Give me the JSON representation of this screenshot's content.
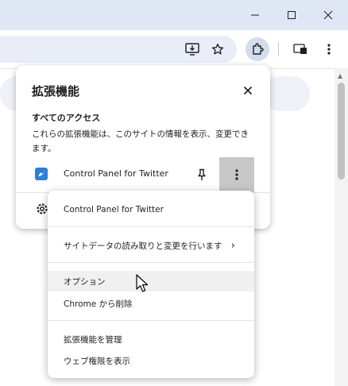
{
  "window": {
    "controls": [
      "minimize-icon",
      "maximize-icon",
      "close-icon"
    ]
  },
  "toolbar": {
    "icons": [
      "install-app-icon",
      "bookmark-star-icon",
      "extensions-puzzle-icon",
      "cast-icon",
      "kebab-menu-icon"
    ]
  },
  "popup": {
    "title": "拡張機能",
    "access_heading": "すべてのアクセス",
    "access_description": "これらの拡張機能は、このサイトの情報を表示、変更できます。",
    "extension": {
      "name": "Control Panel for Twitter"
    }
  },
  "context_menu": {
    "header": "Control Panel for Twitter",
    "site_data": "サイトデータの読み取りと変更を行います",
    "options": "オプション",
    "remove": "Chrome から削除",
    "manage": "拡張機能を管理",
    "permissions": "ウェブ権限を表示"
  },
  "colors": {
    "titlebar": "#dfe7f5",
    "omnibox": "#e8edf7",
    "extension_icon": "#2d7fd8",
    "hover": "#f0f0f0"
  }
}
